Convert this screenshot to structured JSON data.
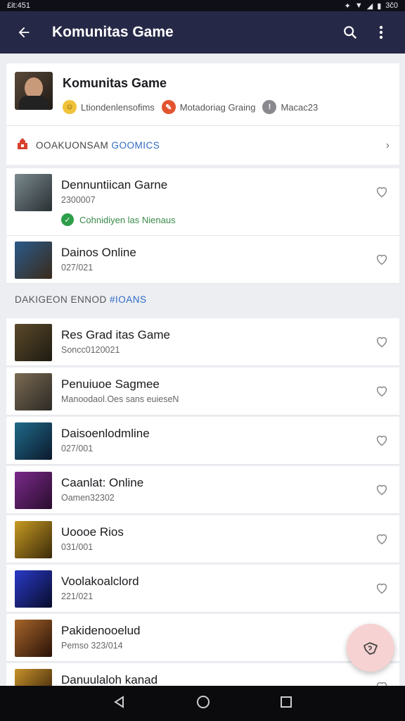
{
  "status_bar": {
    "time": "£it:451",
    "battery": "3č0"
  },
  "app_bar": {
    "title": "Komunitas Game"
  },
  "header": {
    "name": "Komunitas Game",
    "chips": [
      {
        "label": "Ltiondenlensofims",
        "color": "#f0c23a"
      },
      {
        "label": "Motadoriag Graing",
        "color": "#e2542f"
      },
      {
        "label": "Macac23",
        "color": "#8a8a8e"
      }
    ]
  },
  "section_banner": {
    "prefix": "OOAKUONSAM",
    "highlight": "GOOMICS"
  },
  "top_games": [
    {
      "name": "Dennuntiican Garne",
      "sub": "2300007",
      "status": "Cohnidiyen las Nienaus"
    },
    {
      "name": "Dainos Online",
      "sub": "027/021"
    }
  ],
  "subheading": {
    "prefix": "DAKIGEON ENNOD",
    "highlight": "#IOANS"
  },
  "games": [
    {
      "name": "Res Grad itas Game",
      "sub": "Soncc0120021",
      "colors": [
        "#5b4a2a",
        "#1e1a12"
      ]
    },
    {
      "name": "Penuiuoe Sagmee",
      "sub": "Manoodaol.Oes sans euieseN",
      "colors": [
        "#7a6a52",
        "#2d2a26"
      ]
    },
    {
      "name": "Daisoenlodmline",
      "sub": "027/001",
      "colors": [
        "#1f6a8a",
        "#0c1a2c"
      ]
    },
    {
      "name": "Caanlat: Online",
      "sub": "Oamen32302",
      "colors": [
        "#7a2a8a",
        "#2a0d2e"
      ]
    },
    {
      "name": "Uoooe Rios",
      "sub": "031/001",
      "colors": [
        "#c79a22",
        "#3a2a0a"
      ]
    },
    {
      "name": "Voolakoalclord",
      "sub": "221/021",
      "colors": [
        "#2a3ac8",
        "#080c2a"
      ]
    },
    {
      "name": "Pakidenooelud",
      "sub": "Pemso 323/014",
      "colors": [
        "#a6652a",
        "#2a1208"
      ]
    },
    {
      "name": "Danuulaloh kanad",
      "sub": "",
      "colors": [
        "#c7922a",
        "#2a1608"
      ]
    }
  ]
}
